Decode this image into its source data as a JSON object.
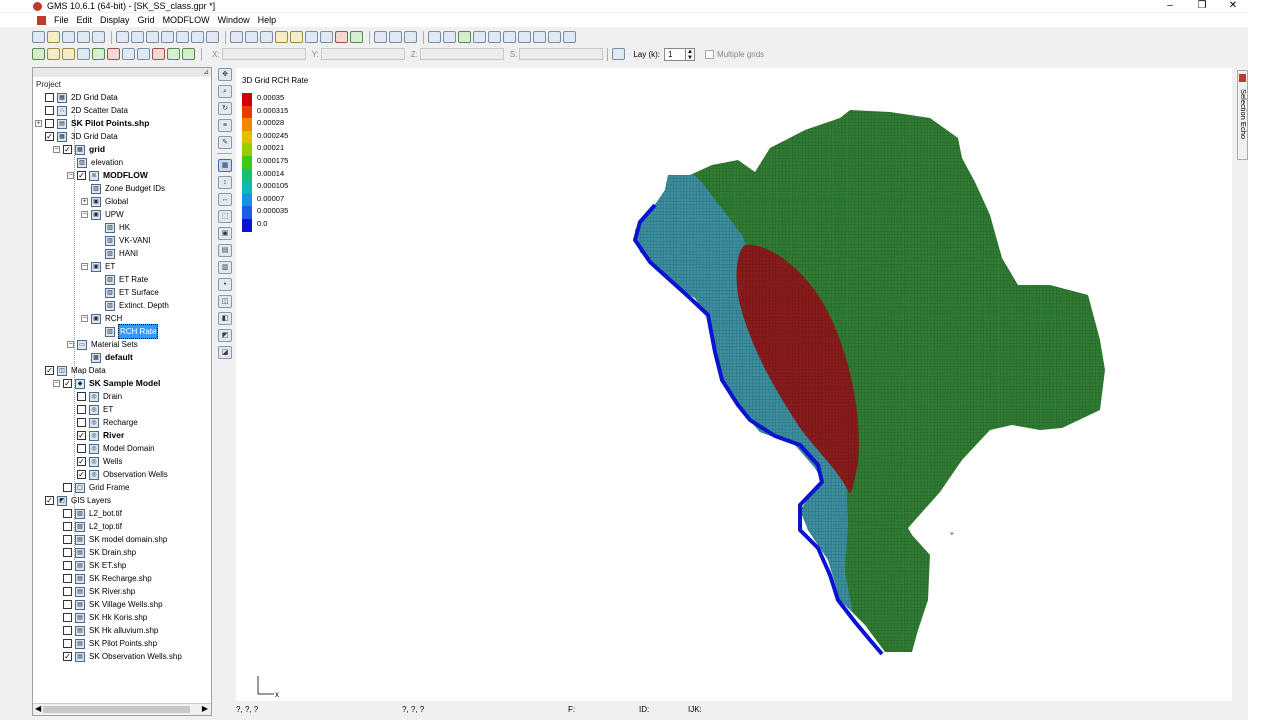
{
  "window": {
    "title": "GMS 10.6.1 (64-bit) - [SK_SS_class.gpr *]",
    "minimize": "–",
    "maximize": "❐",
    "close": "✕"
  },
  "menu": [
    "File",
    "Edit",
    "Display",
    "Grid",
    "MODFLOW",
    "Window",
    "Help"
  ],
  "toolbar": {
    "x_label": "X:",
    "y_label": "Y:",
    "z_label": "Z:",
    "s_label": "S:",
    "lay_label": "Lay (k):",
    "lay_value": "1",
    "multiple_grids_label": "Multiple grids"
  },
  "explorer": {
    "title": "Project",
    "tree": [
      {
        "label": "2D Grid Data",
        "level": 0,
        "exp": "",
        "check": "",
        "icon": "grid-2d-icon",
        "bold": false
      },
      {
        "label": "2D Scatter Data",
        "level": 0,
        "exp": "",
        "check": "",
        "icon": "scatter-2d-icon",
        "bold": false
      },
      {
        "label": "SK Pilot Points.shp",
        "level": 0,
        "exp": "+",
        "check": "",
        "icon": "shapefile-icon",
        "bold": true
      },
      {
        "label": "3D Grid Data",
        "level": 0,
        "exp": "",
        "check": "✓",
        "icon": "grid-3d-icon",
        "bold": false
      },
      {
        "label": "grid",
        "level": 1,
        "exp": "−",
        "check": "✓",
        "icon": "grid-icon",
        "bold": true
      },
      {
        "label": "elevation",
        "level": 2,
        "exp": "",
        "check": "none",
        "icon": "dataset-icon",
        "bold": false
      },
      {
        "label": "MODFLOW",
        "level": 2,
        "exp": "−",
        "check": "✓",
        "icon": "modflow-icon",
        "bold": true
      },
      {
        "label": "Zone Budget IDs",
        "level": 3,
        "exp": "",
        "check": "none",
        "icon": "dataset-icon",
        "bold": false
      },
      {
        "label": "Global",
        "level": 3,
        "exp": "+",
        "check": "none",
        "icon": "package-icon",
        "bold": false
      },
      {
        "label": "UPW",
        "level": 3,
        "exp": "−",
        "check": "none",
        "icon": "package-icon",
        "bold": false
      },
      {
        "label": "HK",
        "level": 4,
        "exp": "",
        "check": "none",
        "icon": "dataset-icon",
        "bold": false
      },
      {
        "label": "VK-VANI",
        "level": 4,
        "exp": "",
        "check": "none",
        "icon": "dataset-icon",
        "bold": false
      },
      {
        "label": "HANI",
        "level": 4,
        "exp": "",
        "check": "none",
        "icon": "dataset-icon",
        "bold": false
      },
      {
        "label": "ET",
        "level": 3,
        "exp": "−",
        "check": "none",
        "icon": "package-icon",
        "bold": false
      },
      {
        "label": "ET Rate",
        "level": 4,
        "exp": "",
        "check": "none",
        "icon": "dataset-icon",
        "bold": false
      },
      {
        "label": "ET Surface",
        "level": 4,
        "exp": "",
        "check": "none",
        "icon": "dataset-icon",
        "bold": false
      },
      {
        "label": "Extinct. Depth",
        "level": 4,
        "exp": "",
        "check": "none",
        "icon": "dataset-icon",
        "bold": false
      },
      {
        "label": "RCH",
        "level": 3,
        "exp": "−",
        "check": "none",
        "icon": "package-icon",
        "bold": false
      },
      {
        "label": "RCH Rate",
        "level": 4,
        "exp": "",
        "check": "none",
        "icon": "dataset-icon",
        "bold": false,
        "selected": true
      },
      {
        "label": "Material Sets",
        "level": 2,
        "exp": "−",
        "check": "none",
        "icon": "folder-icon",
        "bold": false
      },
      {
        "label": "default",
        "level": 3,
        "exp": "",
        "check": "none",
        "icon": "material-icon",
        "bold": true
      },
      {
        "label": "Map Data",
        "level": 0,
        "exp": "",
        "check": "✓",
        "icon": "map-data-icon",
        "bold": false
      },
      {
        "label": "SK Sample Model",
        "level": 1,
        "exp": "−",
        "check": "✓",
        "icon": "conceptual-model-icon",
        "bold": true
      },
      {
        "label": "Drain",
        "level": 2,
        "exp": "",
        "check": "",
        "icon": "coverage-icon",
        "bold": false
      },
      {
        "label": "ET",
        "level": 2,
        "exp": "",
        "check": "",
        "icon": "coverage-icon",
        "bold": false
      },
      {
        "label": "Recharge",
        "level": 2,
        "exp": "",
        "check": "",
        "icon": "coverage-icon",
        "bold": false
      },
      {
        "label": "River",
        "level": 2,
        "exp": "",
        "check": "✓",
        "icon": "coverage-icon",
        "bold": true
      },
      {
        "label": "Model Domain",
        "level": 2,
        "exp": "",
        "check": "",
        "icon": "coverage-icon",
        "bold": false
      },
      {
        "label": "Wells",
        "level": 2,
        "exp": "",
        "check": "✓",
        "icon": "coverage-icon",
        "bold": false
      },
      {
        "label": "Observation Wells",
        "level": 2,
        "exp": "",
        "check": "✓",
        "icon": "coverage-icon",
        "bold": false
      },
      {
        "label": "Grid Frame",
        "level": 1,
        "exp": "",
        "check": "",
        "icon": "grid-frame-icon",
        "bold": false
      },
      {
        "label": "GIS Layers",
        "level": 0,
        "exp": "",
        "check": "✓",
        "icon": "gis-layers-icon",
        "bold": false
      },
      {
        "label": "L2_bot.tif",
        "level": 1,
        "exp": "",
        "check": "",
        "icon": "raster-icon",
        "bold": false
      },
      {
        "label": "L2_top.tif",
        "level": 1,
        "exp": "",
        "check": "",
        "icon": "raster-icon",
        "bold": false
      },
      {
        "label": "SK model domain.shp",
        "level": 1,
        "exp": "",
        "check": "",
        "icon": "shapefile-icon",
        "bold": false
      },
      {
        "label": "SK Drain.shp",
        "level": 1,
        "exp": "",
        "check": "",
        "icon": "shapefile-icon",
        "bold": false
      },
      {
        "label": "SK ET.shp",
        "level": 1,
        "exp": "",
        "check": "",
        "icon": "shapefile-icon",
        "bold": false
      },
      {
        "label": "SK Recharge.shp",
        "level": 1,
        "exp": "",
        "check": "",
        "icon": "shapefile-icon",
        "bold": false
      },
      {
        "label": "SK River.shp",
        "level": 1,
        "exp": "",
        "check": "",
        "icon": "shapefile-icon",
        "bold": false
      },
      {
        "label": "SK Village Wells.shp",
        "level": 1,
        "exp": "",
        "check": "",
        "icon": "shapefile-icon",
        "bold": false
      },
      {
        "label": "SK Hk Koris.shp",
        "level": 1,
        "exp": "",
        "check": "",
        "icon": "shapefile-icon",
        "bold": false
      },
      {
        "label": "SK Hk alluvium.shp",
        "level": 1,
        "exp": "",
        "check": "",
        "icon": "shapefile-icon",
        "bold": false
      },
      {
        "label": "SK Pilot Points.shp",
        "level": 1,
        "exp": "",
        "check": "",
        "icon": "shapefile-icon",
        "bold": false
      },
      {
        "label": "SK Observation Wells.shp",
        "level": 1,
        "exp": "",
        "check": "✓",
        "icon": "shapefile-icon",
        "bold": false
      }
    ]
  },
  "graphics": {
    "legend_title": "3D Grid RCH Rate",
    "legend": [
      {
        "label": "0.00035",
        "color": "#d40000"
      },
      {
        "label": "0.000315",
        "color": "#e83a00"
      },
      {
        "label": "0.00028",
        "color": "#ee8800"
      },
      {
        "label": "0.000245",
        "color": "#e2c000"
      },
      {
        "label": "0.00021",
        "color": "#9acd00"
      },
      {
        "label": "0.000175",
        "color": "#3ec81c"
      },
      {
        "label": "0.00014",
        "color": "#16c070"
      },
      {
        "label": "0.000105",
        "color": "#10b8b4"
      },
      {
        "label": "0.00007",
        "color": "#1a8ee0"
      },
      {
        "label": "0.000035",
        "color": "#1a5ee8"
      },
      {
        "label": "0.0",
        "color": "#0a14d0"
      }
    ],
    "axis_label": "x",
    "probe_marker": "+"
  },
  "side_panel": {
    "label": "Selection Echo"
  },
  "status": {
    "xyz": "?, ?, ?",
    "ijk": "?, ?, ?",
    "f_label": "F:",
    "id_label": "ID:",
    "ijk_label": "IJK:"
  },
  "colors": {
    "selection": "#3399ff",
    "grid_high": "#8b1a1a",
    "grid_mid": "#2e7d32",
    "grid_low": "#3a8fa0",
    "boundary": "#0a14d0"
  }
}
